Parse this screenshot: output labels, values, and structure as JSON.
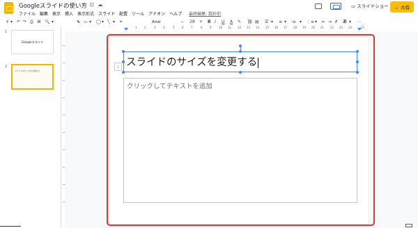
{
  "header": {
    "doc_title": "Googleスライドの使い方",
    "title_icons": [
      "star-icon",
      "folder-move-icon",
      "cloud-status-icon"
    ],
    "menu": [
      "ファイル",
      "編集",
      "表示",
      "挿入",
      "表示形式",
      "スライド",
      "配置",
      "ツール",
      "アドオン",
      "ヘルプ"
    ],
    "last_edit": "最終編集: 数秒前",
    "slideshow_label": "スライドショー",
    "share_label": "共有",
    "accent_color": "#fbbc04"
  },
  "toolbar": {
    "left_tools": [
      "+",
      "▾",
      "↶",
      "↷",
      "⎙",
      "⌘",
      "🔍",
      "▾"
    ],
    "mid_tools": [
      "⬉",
      "▭",
      "▾",
      "◯",
      "▾",
      "╲",
      "▾",
      "⌗"
    ],
    "font_name": "Arial",
    "font_size": "28",
    "format_tools": [
      "B",
      "I",
      "U",
      "A",
      "✎",
      "⛓",
      "▤",
      "☰",
      "▾",
      "≡",
      "▾",
      "⁝≡",
      "▾",
      "⋮≡",
      "▾",
      "⇤",
      "⇥",
      "✗",
      "あ",
      "▾",
      "⋯"
    ]
  },
  "filmstrip": {
    "slides": [
      {
        "number": "1",
        "text": "Googleスライド"
      },
      {
        "number": "2",
        "text": "スライドのサイズを変更する"
      }
    ]
  },
  "ruler": {
    "marks": [
      "1",
      "2",
      "3",
      "4",
      "5",
      "6",
      "7",
      "8",
      "9",
      "10",
      "11",
      "12",
      "13",
      "14",
      "15",
      "16",
      "17",
      "18",
      "19",
      "20",
      "21",
      "22",
      "23",
      "24",
      "25"
    ]
  },
  "slide": {
    "title": "スライドのサイズを変更する",
    "body_placeholder": "クリックしてテキストを追加"
  }
}
